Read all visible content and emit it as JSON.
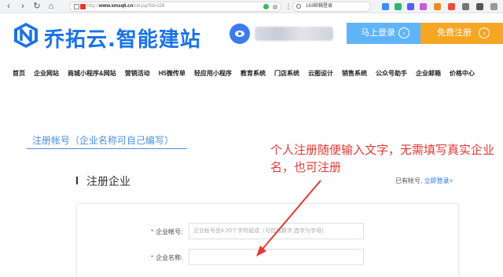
{
  "browser": {
    "url_protocol": "http://",
    "url_host": "www.xmsq6.cn",
    "url_path": "/col.jsp?id=128",
    "search_text": "163邮箱登录"
  },
  "header": {
    "logo_text": "乔拓云.智能建站",
    "login_label": "马上登录",
    "register_label": "免费注册",
    "arrow_glyph": "›",
    "brand_color": "#1a73e8",
    "login_color": "#5fb4f7",
    "register_color": "#f5a623"
  },
  "nav": {
    "items": [
      "首页",
      "企业网站",
      "商城小程序&网站",
      "营销活动",
      "H5微传单",
      "轻应用小程序",
      "教育系统",
      "门店系统",
      "云图设计",
      "销售系统",
      "公众号助手",
      "企业邮箱",
      "价格中心"
    ]
  },
  "form": {
    "tab_title": "注册帐号（企业名称可自己编写）",
    "section_title": "注册企业",
    "have_account_text": "已有帐号,",
    "login_link": "立即登录>",
    "required_mark": "*",
    "fields": [
      {
        "label": "企业帐号:",
        "placeholder": "企业帐号由4-20个字符组成（可包括数字,首字为字母)"
      },
      {
        "label": "企业名称:",
        "placeholder": ""
      }
    ]
  },
  "annotation": {
    "text": "个人注册随便输入文字，无需填写真实企业名，也可注册",
    "color": "#e53935"
  }
}
